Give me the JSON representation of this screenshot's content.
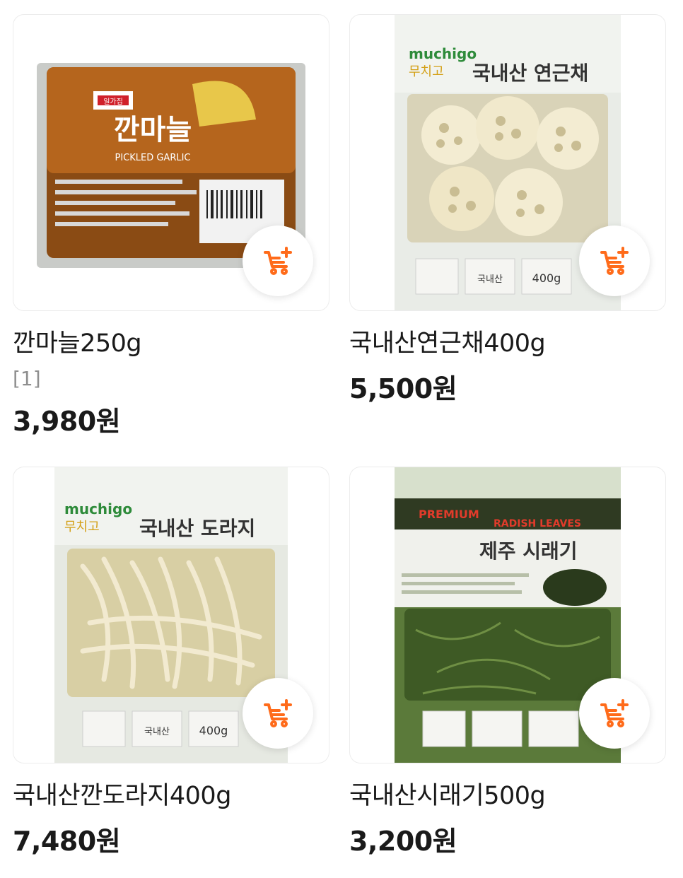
{
  "products": [
    {
      "name": "깐마늘250g",
      "tag": "[1]",
      "price": "3,980원"
    },
    {
      "name": "국내산연근채400g",
      "price": "5,500원"
    },
    {
      "name": "국내산깐도라지400g",
      "price": "7,480원"
    },
    {
      "name": "국내산시래기500g",
      "price": "3,200원"
    }
  ],
  "package_text": {
    "garlic_title": "깐마늘",
    "garlic_en": "PICKLED GARLIC",
    "garlic_brand": "일가집",
    "brand_en": "muchigo",
    "brand_ko": "무치고",
    "lotus_title": "국내산 연근채",
    "lotus_weight": "400g",
    "bellflower_title": "국내산 도라지",
    "bellflower_weight": "400g",
    "radish_premium": "PREMIUM",
    "radish_en": "RADISH LEAVES",
    "radish_title": "제주 시래기",
    "origin": "국내산"
  },
  "icons": {
    "cart_add": "cart-plus-icon"
  },
  "colors": {
    "accent": "#ff6b1a",
    "text": "#1a1a1a",
    "muted": "#8f8f8f"
  }
}
